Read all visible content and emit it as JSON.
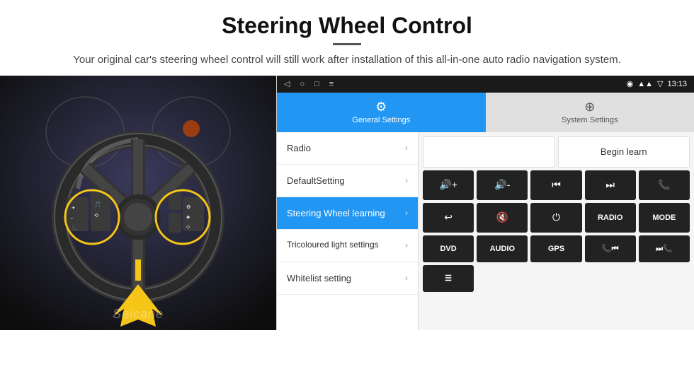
{
  "header": {
    "title": "Steering Wheel Control",
    "description": "Your original car's steering wheel control will still work after installation of this all-in-one auto radio navigation system."
  },
  "status_bar": {
    "nav_back": "◁",
    "nav_home": "○",
    "nav_recent": "□",
    "nav_menu": "≡",
    "signal": "▲▲",
    "wifi": "▼",
    "time": "13:13",
    "gps": "◉"
  },
  "tabs": {
    "active": {
      "label": "General Settings",
      "icon": "⚙"
    },
    "inactive": {
      "label": "System Settings",
      "icon": "⊕"
    }
  },
  "menu": {
    "items": [
      {
        "label": "Radio",
        "active": false
      },
      {
        "label": "DefaultSetting",
        "active": false
      },
      {
        "label": "Steering Wheel learning",
        "active": true
      },
      {
        "label": "Tricoloured light settings",
        "active": false
      },
      {
        "label": "Whitelist setting",
        "active": false
      }
    ]
  },
  "right_panel": {
    "begin_learn_label": "Begin learn",
    "control_buttons": [
      {
        "icon": "🔊+",
        "symbol": "vol_up"
      },
      {
        "icon": "🔊-",
        "symbol": "vol_down"
      },
      {
        "icon": "⏮",
        "symbol": "prev"
      },
      {
        "icon": "⏭",
        "symbol": "next"
      },
      {
        "icon": "📞",
        "symbol": "call"
      },
      {
        "icon": "↩",
        "symbol": "hang_up"
      },
      {
        "icon": "🔇",
        "symbol": "mute"
      },
      {
        "icon": "⏻",
        "symbol": "power"
      },
      {
        "text": "RADIO",
        "symbol": "radio"
      },
      {
        "text": "MODE",
        "symbol": "mode"
      }
    ],
    "bottom_buttons": [
      {
        "text": "DVD"
      },
      {
        "text": "AUDIO"
      },
      {
        "text": "GPS"
      },
      {
        "icon": "📞⏮",
        "symbol": "call_prev"
      },
      {
        "icon": "⏭📞",
        "symbol": "call_next"
      }
    ],
    "last_buttons": [
      {
        "icon": "≡",
        "symbol": "menu_icon"
      }
    ]
  },
  "watermark": "Seicane"
}
